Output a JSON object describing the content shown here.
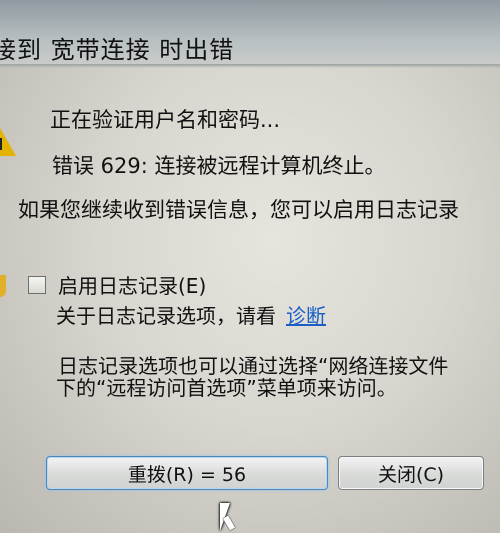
{
  "dialog": {
    "title": "接到 宽带连接 时出错",
    "status_text": "正在验证用户名和密码...",
    "error_text": "错误 629: 连接被远程计算机终止。",
    "continue_text": "如果您继续收到错误信息，您可以启用日志记录"
  },
  "logging": {
    "checkbox_label": "启用日志记录(E)",
    "checkbox_checked": false,
    "about_text": "关于日志记录选项，请看",
    "diagnose_link": "诊断",
    "options_line1": "日志记录选项也可以通过选择“网络连接文件",
    "options_line2": "下的“远程访问首选项”菜单项来访问。"
  },
  "buttons": {
    "redial_label": "重拨(R) = 56",
    "close_label": "关闭(C)"
  },
  "icons": {
    "warning": "warning-icon",
    "shield": "shield-icon",
    "cursor": "mouse-cursor-icon"
  }
}
